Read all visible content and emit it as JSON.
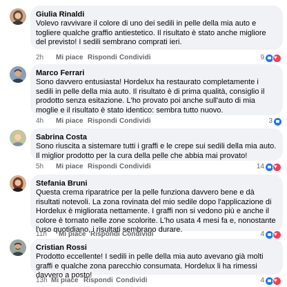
{
  "comments": [
    {
      "author": "Giulia Rinaldi",
      "text": "Volevo ravvivare il colore di uno dei sedili in pelle della mia auto e togliere qualche graffio antiestetico. Il risultato è stato anche migliore del previsto! I sedili sembrano comprati ieri.",
      "time": "2h",
      "like_label": "Mi piace",
      "reply_label": "Rispondi",
      "share_label": "Condividi",
      "reaction_count": "9",
      "reactions": [
        "like-icon",
        "love-icon"
      ],
      "avatar_colors": {
        "bg": "#c9a58a",
        "hair": "#6b4a34",
        "skin": "#e9c3a6"
      }
    },
    {
      "author": "Marco Ferrari",
      "text": "Sono davvero entusiasta! Hordelux ha restaurato completamente i sedili in pelle della mia auto. Il risultato è di prima qualità, consiglio il prodotto senza esitazione. L'ho provato poi anche sull'auto di mia moglie e il risultato è stato identico: sembra tutto nuovo.",
      "time": "4h",
      "like_label": "Mi piace",
      "reply_label": "Rispondi",
      "share_label": "Condividi",
      "reaction_count": "3",
      "reactions": [
        "like-icon"
      ],
      "avatar_colors": {
        "bg": "#8aa0b8",
        "hair": "#3b2a20",
        "skin": "#d9a98a"
      }
    },
    {
      "author": "Sabrina Costa",
      "text": "Sono riuscita a sistemare tutti i graffi e le crepe sui sedili della mia auto. Il miglior prodotto per la cura della pelle che abbia mai provato!",
      "time": "5h",
      "like_label": "Mi piace",
      "reply_label": "Rispondi",
      "share_label": "Condividi",
      "reaction_count": "14",
      "reactions": [
        "like-icon",
        "love-icon"
      ],
      "avatar_colors": {
        "bg": "#b9c9a8",
        "hair": "#d8c08a",
        "skin": "#f0d2bc"
      }
    },
    {
      "author": "Stefania Bruni",
      "text": "Questa crema riparatrice per la pelle funziona davvero bene e dà risultati notevoli. La zona rovinata del mio sedile dopo l'applicazione di Hordelux è migliorata nettamente. I graffi non si vedono più e anche il colore è tornato nelle zone scolorite. L'ho usata 4 mesi fa e, nonostante l'uso quotidiano, i risultati sembrano durare.",
      "time": "11h",
      "like_label": "Mi piace",
      "reply_label": "Rispondi",
      "share_label": "Condividi",
      "reaction_count": "4",
      "reactions": [
        "like-icon",
        "love-icon"
      ],
      "avatar_colors": {
        "bg": "#d7b08f",
        "hair": "#7a3b22",
        "skin": "#eac0a4"
      }
    },
    {
      "author": "Cristian Rossi",
      "text": "Prodotto eccellente! I sedili in pelle della mia auto avevano già molti graffi e qualche zona parecchio consumata. Hordelux li ha rimessi davvero a posto!",
      "time": "13h",
      "like_label": "Mi piace",
      "reply_label": "Rispondi",
      "share_label": "Condividi",
      "reaction_count": "4",
      "reactions": [
        "like-icon",
        "love-icon"
      ],
      "avatar_colors": {
        "bg": "#9aa7a0",
        "hair": "#2e2620",
        "skin": "#d6a586"
      }
    }
  ],
  "colors": {
    "bubble": "#f0f2f5",
    "meta_text": "#65676b",
    "like_blue": "#1877f2",
    "love_red": "#f33e58"
  }
}
